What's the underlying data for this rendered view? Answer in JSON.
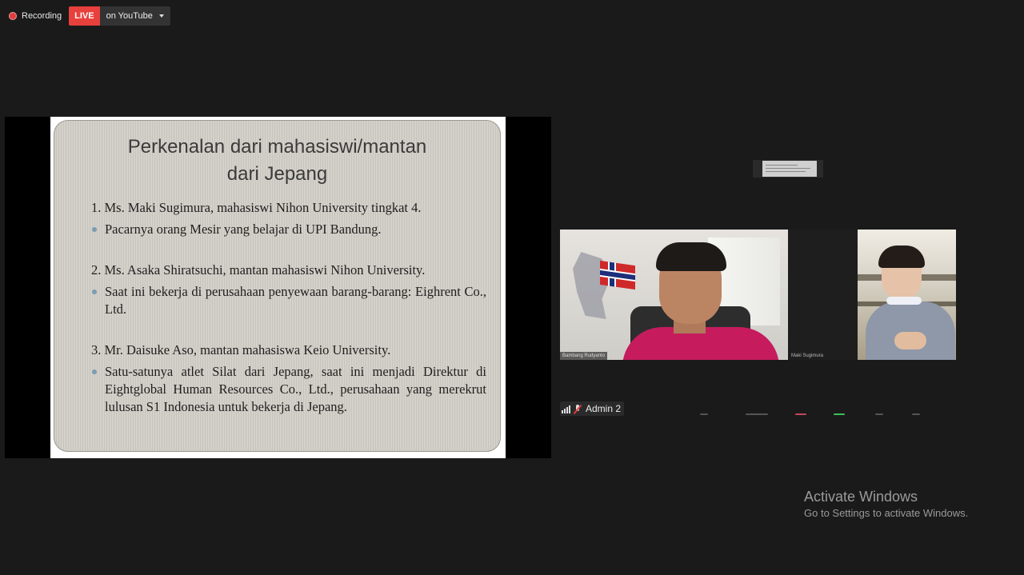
{
  "recording": {
    "label": "Recording",
    "live_label": "LIVE",
    "platform_label": "on YouTube"
  },
  "slide": {
    "title_line1": "Perkenalan dari mahasiswi/mantan",
    "title_line2": "dari Jepang",
    "items": [
      {
        "head": "1. Ms. Maki Sugimura, mahasiswi Nihon University tingkat 4.",
        "bullet": "Pacarnya orang Mesir yang belajar di UPI Bandung."
      },
      {
        "head": "2. Ms. Asaka Shiratsuchi, mantan mahasiswi Nihon University.",
        "bullet": "Saat ini bekerja di perusahaan penyewaan barang-barang: Eighrent Co., Ltd."
      },
      {
        "head": "3. Mr. Daisuke Aso, mantan mahasiswa Keio University.",
        "bullet": "Satu-satunya atlet Silat dari Jepang, saat ini menjadi Direktur di Eightglobal Human Resources Co., Ltd., perusahaan yang merekrut lulusan S1 Indonesia untuk bekerja di Jepang."
      }
    ],
    "accent_color": "#7c9cb0"
  },
  "gallery": {
    "participants": [
      {
        "name": "Bambang Rudyanto"
      },
      {
        "name": "Maki Sugimura"
      }
    ],
    "self_view": {
      "name": "Admin 2",
      "muted": true
    }
  },
  "watermark": {
    "title": "Activate Windows",
    "subtitle": "Go to Settings to activate Windows."
  },
  "colors": {
    "background": "#1a1a1a",
    "live_red": "#e8403c",
    "recording_dot": "#e03c3c"
  }
}
